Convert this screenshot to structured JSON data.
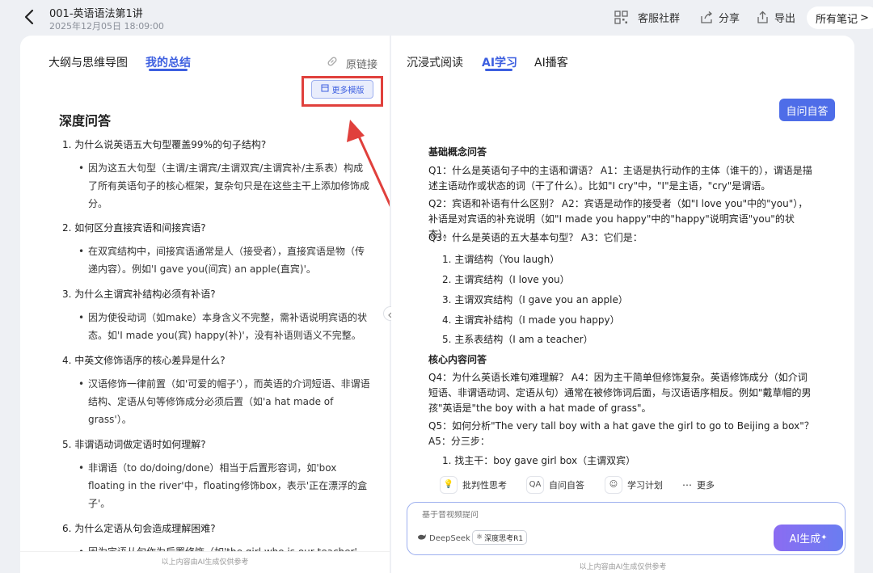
{
  "header": {
    "title": "001-英语语法第1讲",
    "date": "2025年12月05日 18:09:00",
    "service_group": "客服社群",
    "share": "分享",
    "export": "导出",
    "all_notes": "所有笔记",
    "all_notes_chevron": ">"
  },
  "left": {
    "tabs": [
      "大纲与思维导图",
      "我的总结"
    ],
    "original_link": "原链接",
    "more_templates": "更多模版",
    "section_title": "深度问答",
    "qa": [
      {
        "q": "1. 为什么说英语五大句型覆盖99%的句子结构?",
        "a": "因为这五大句型（主谓/主谓宾/主谓双宾/主谓宾补/主系表）构成了所有英语句子的核心框架，复杂句只是在这些主干上添加修饰成分。"
      },
      {
        "q": "2. 如何区分直接宾语和间接宾语?",
        "a": "在双宾结构中，间接宾语通常是人（接受者），直接宾语是物（传递内容）。例如'I gave you(间宾) an apple(直宾)'。"
      },
      {
        "q": "3. 为什么主谓宾补结构必须有补语?",
        "a": "因为使役动词（如make）本身含义不完整，需补语说明宾语的状态。如'I made you(宾) happy(补)'，没有补语则语义不完整。"
      },
      {
        "q": "4. 中英文修饰语序的核心差异是什么?",
        "a": "汉语修饰一律前置（如'可爱的帽子'），而英语的介词短语、非谓语结构、定语从句等修饰成分必须后置（如'a hat made of grass'）。"
      },
      {
        "q": "5. 非谓语动词做定语时如何理解?",
        "a": "非谓语（to do/doing/done）相当于后置形容词，如'box floating in the river'中，floating修饰box，表示'正在漂浮的盒子'。"
      },
      {
        "q": "6. 为什么定语从句会造成理解困难?",
        "a": "因为定语从句作为后置修饰（如'the girl who is our teacher'"
      }
    ],
    "footer": "以上内容由AI生成仅供参考"
  },
  "right": {
    "tabs": [
      "沉浸式阅读",
      "AI学习",
      "AI播客"
    ],
    "self_qa_button": "自问自答",
    "h1": "基础概念问答",
    "q1": "Q1：什么是英语句子中的主语和谓语？ A1：主语是执行动作的主体（谁干的），谓语是描述主语动作或状态的词（干了什么）。比如\"I cry\"中，\"I\"是主语，\"cry\"是谓语。",
    "q2": "Q2：宾语和补语有什么区别？ A2：宾语是动作的接受者（如\"I love you\"中的\"you\"），补语是对宾语的补充说明（如\"I made you happy\"中的\"happy\"说明宾语\"you\"的状态）。",
    "q3": "Q3：什么是英语的五大基本句型？ A3：它们是：",
    "patterns": [
      "1. 主谓结构（You laugh）",
      "2. 主谓宾结构（I love you）",
      "3. 主谓双宾结构（I gave you an apple）",
      "4. 主谓宾补结构（I made you happy）",
      "5. 主系表结构（I am a teacher）"
    ],
    "h2": "核心内容问答",
    "q4": "Q4：为什么英语长难句难理解？ A4：因为主干简单但修饰复杂。英语修饰成分（如介词短语、非谓语动词、定语从句）通常在被修饰词后面，与汉语语序相反。例如\"戴草帽的男孩\"英语是\"the boy with a hat made of grass\"。",
    "q5": "Q5：如何分析\"The very tall boy with a hat gave the girl to go to Beijing a box\"？ A5：分三步：",
    "step1": "1. 找主干：boy gave girl box（主谓双宾）",
    "chips": [
      "批判性思考",
      "自问自答",
      "学习计划",
      "更多"
    ],
    "chip_icons": [
      "bulb-icon",
      "qa-icon",
      "plan-icon",
      "more-icon"
    ],
    "input_placeholder": "基于音视频提问",
    "deepseek": "DeepSeek",
    "deep_think": "深度思考R1",
    "ai_generate": "AI生成",
    "footer": "以上内容由AI生成仅供参考"
  },
  "colors": {
    "accent": "#3d5fe0",
    "highlight_frame": "#e0403c"
  }
}
